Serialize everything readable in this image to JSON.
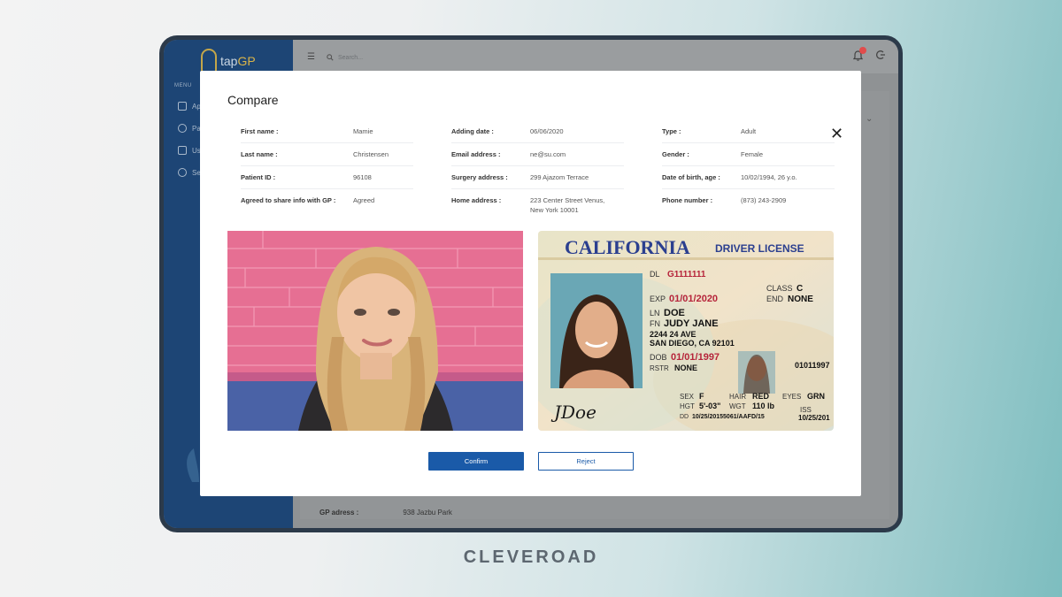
{
  "app": {
    "logo_prefix": "tap",
    "logo_suffix": "GP",
    "menu_caption": "MENU",
    "sidebar_items": [
      {
        "label": "Ap",
        "icon": "calendar-icon"
      },
      {
        "label": "Pa",
        "icon": "user-circle-icon"
      },
      {
        "label": "Us",
        "icon": "chart-icon"
      },
      {
        "label": "Se",
        "icon": "settings-icon"
      }
    ],
    "search_placeholder": "Search...",
    "notification_icon": "bell-icon",
    "logout_icon": "logout-icon"
  },
  "background_page": {
    "gp_address_label": "GP adress :",
    "gp_address_value": "938 Jazbu Park"
  },
  "modal": {
    "title": "Compare",
    "close_icon": "close-icon",
    "columns": [
      [
        {
          "label": "First name :",
          "value": "Mamie"
        },
        {
          "label": "Last name :",
          "value": "Christensen"
        },
        {
          "label": "Patient ID :",
          "value": "96108"
        },
        {
          "label": "Agreed to share info with GP :",
          "value": "Agreed"
        }
      ],
      [
        {
          "label": "Adding date :",
          "value": "06/06/2020"
        },
        {
          "label": "Email address :",
          "value": "ne@su.com"
        },
        {
          "label": "Surgery address :",
          "value": "299 Ajazom Terrace"
        },
        {
          "label": "Home address :",
          "value": "223 Center Street Venus, New York 10001"
        }
      ],
      [
        {
          "label": "Type :",
          "value": "Adult"
        },
        {
          "label": "Gender :",
          "value": "Female"
        },
        {
          "label": "Date of birth, age :",
          "value": "10/02/1994, 26 y.o."
        },
        {
          "label": "Phone number :",
          "value": "(873) 243-2909"
        }
      ]
    ],
    "license": {
      "state": "CALIFORNIA",
      "doc_type": "DRIVER LICENSE",
      "dl_label": "DL",
      "dl_value": "G1111111",
      "exp_label": "EXP",
      "exp_value": "01/01/2020",
      "class_label": "CLASS",
      "class_value": "C",
      "end_label": "END",
      "end_value": "NONE",
      "ln_label": "LN",
      "ln_value": "DOE",
      "fn_label": "FN",
      "fn_value": "JUDY JANE",
      "address_line1": "2244 24 AVE",
      "address_line2": "SAN DIEGO, CA 92101",
      "dob_label": "DOB",
      "dob_value": "01/01/1997",
      "rstr_label": "RSTR",
      "rstr_value": "NONE",
      "number": "01011997",
      "sex_label": "SEX",
      "sex_value": "F",
      "hair_label": "HAIR",
      "hair_value": "RED",
      "eyes_label": "EYES",
      "eyes_value": "GRN",
      "hgt_label": "HGT",
      "hgt_value": "5'-03\"",
      "wgt_label": "WGT",
      "wgt_value": "110 lb",
      "iss_label": "ISS",
      "iss_value": "10/25/201",
      "dd_label": "DD",
      "dd_value": "10/25/20155061/AAFD/15",
      "signature": "JDoe"
    },
    "confirm_label": "Confirm",
    "reject_label": "Reject"
  },
  "brand": "CLEVEROAD"
}
